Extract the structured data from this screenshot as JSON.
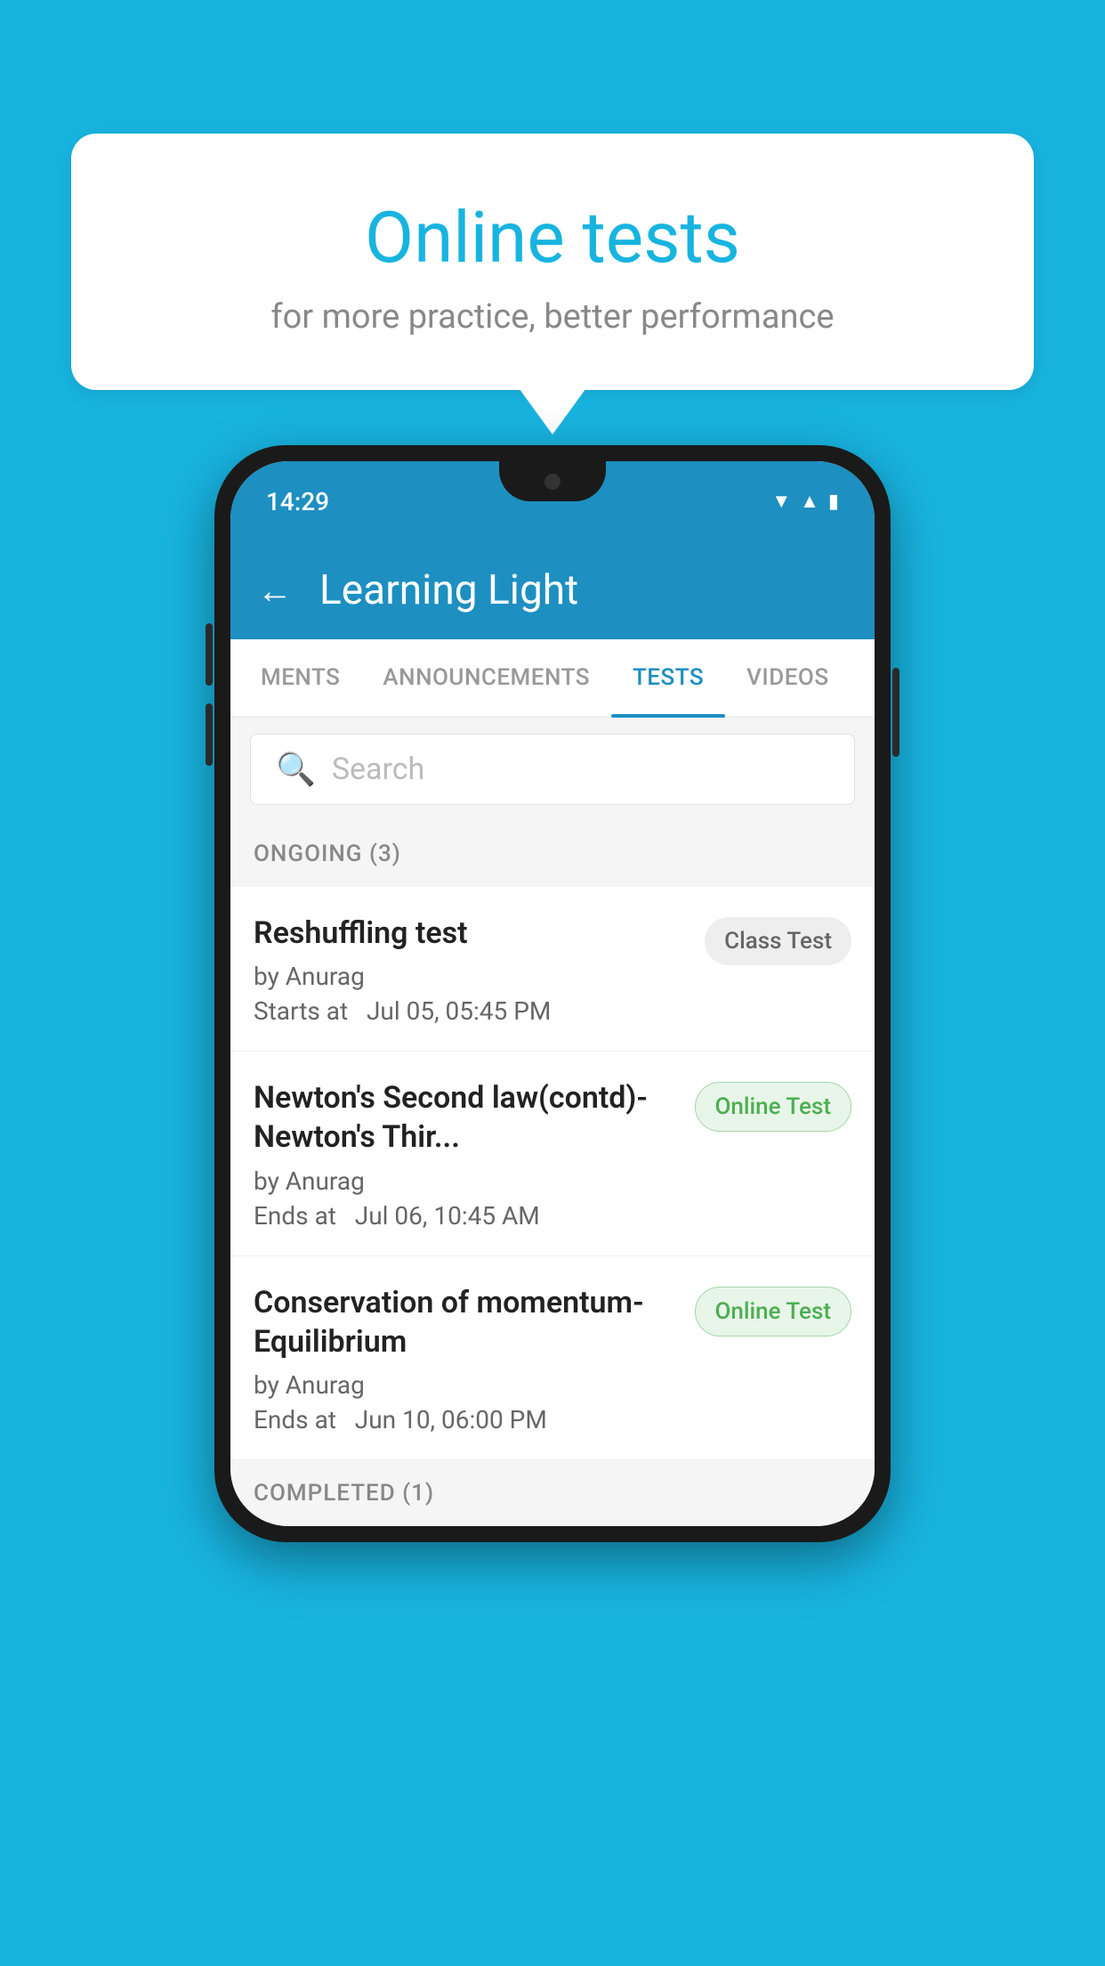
{
  "background": {
    "color": "#18b4e0"
  },
  "speech_bubble": {
    "title": "Online tests",
    "subtitle": "for more practice, better performance"
  },
  "phone": {
    "status_bar": {
      "time": "14:29",
      "icons": [
        "wifi",
        "signal",
        "battery"
      ]
    },
    "app_header": {
      "back_label": "←",
      "title": "Learning Light"
    },
    "tabs": [
      {
        "label": "MENTS",
        "active": false
      },
      {
        "label": "ANNOUNCEMENTS",
        "active": false
      },
      {
        "label": "TESTS",
        "active": true
      },
      {
        "label": "VIDEOS",
        "active": false
      }
    ],
    "search": {
      "placeholder": "Search"
    },
    "ongoing_section": {
      "label": "ONGOING (3)"
    },
    "tests": [
      {
        "name": "Reshuffling test",
        "author": "by Anurag",
        "time_label": "Starts at",
        "time": "Jul 05, 05:45 PM",
        "badge": "Class Test",
        "badge_type": "class"
      },
      {
        "name": "Newton's Second law(contd)-Newton's Thir...",
        "author": "by Anurag",
        "time_label": "Ends at",
        "time": "Jul 06, 10:45 AM",
        "badge": "Online Test",
        "badge_type": "online"
      },
      {
        "name": "Conservation of momentum-Equilibrium",
        "author": "by Anurag",
        "time_label": "Ends at",
        "time": "Jun 10, 06:00 PM",
        "badge": "Online Test",
        "badge_type": "online"
      }
    ],
    "completed_section": {
      "label": "COMPLETED (1)"
    }
  }
}
